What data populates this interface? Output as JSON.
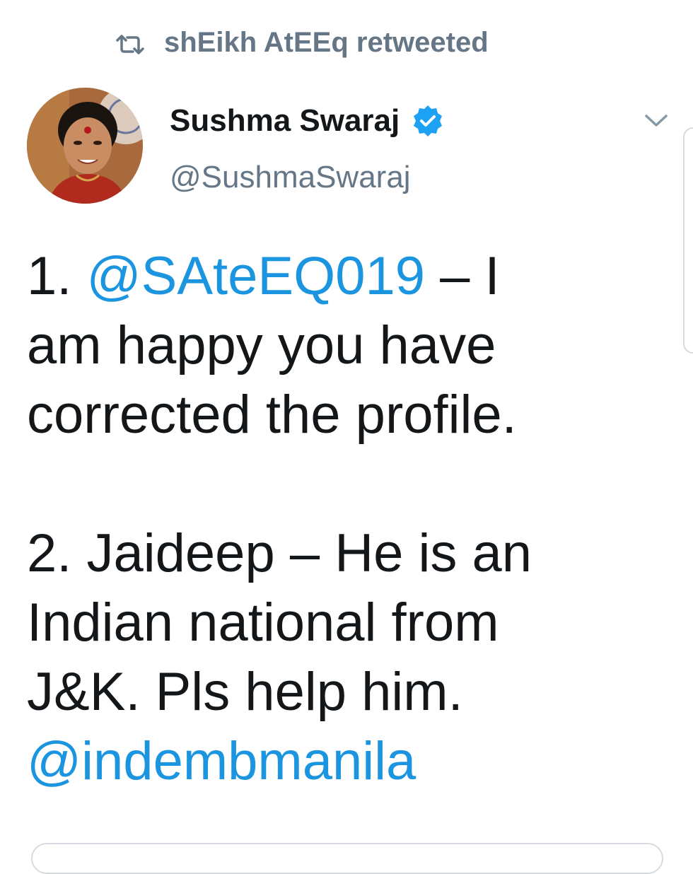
{
  "retweet": {
    "icon": "retweet-icon",
    "text": "shEikh AtEEq retweeted"
  },
  "author": {
    "display_name": "Sushma Swaraj",
    "handle": "@SushmaSwaraj",
    "verified": true,
    "verified_icon": "verified-badge-icon",
    "avatar": "profile-avatar"
  },
  "menu": {
    "icon": "chevron-down-icon"
  },
  "tweet": {
    "line1_prefix": "1. ",
    "line1_mention": "@SAteEQ019",
    "line1_suffix": " – I",
    "line2": "am happy you have",
    "line3": "corrected the profile.",
    "line4": "2. Jaideep – He is an",
    "line5": "Indian national from",
    "line6": "J&K. Pls help him.",
    "line7_mention": "@indembmanila"
  },
  "colors": {
    "text": "#14171a",
    "secondary": "#657786",
    "link": "#1b95e0",
    "verified": "#1da1f2"
  }
}
